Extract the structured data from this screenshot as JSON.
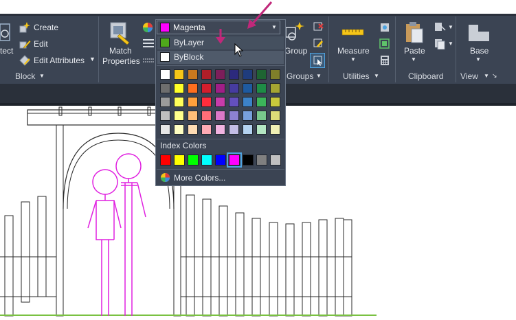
{
  "ribbon": {
    "block_panel": {
      "partial_label": "tect",
      "create_label": "Create",
      "edit_label": "Edit",
      "edit_attributes_label": "Edit Attributes",
      "title": "Block"
    },
    "match_properties": {
      "line1": "Match",
      "line2": "Properties"
    },
    "groups_panel": {
      "group_label": "Group",
      "title": "Groups"
    },
    "utilities_panel": {
      "measure_label": "Measure",
      "title": "Utilities"
    },
    "clipboard_panel": {
      "paste_label": "Paste",
      "title": "Clipboard"
    },
    "view_panel": {
      "base_label": "Base",
      "title": "View"
    }
  },
  "color_dropdown": {
    "selected_label": "Magenta",
    "selected_color": "#ff00ff",
    "bylayer_label": "ByLayer",
    "bylayer_color": "#4fa81b",
    "byblock_label": "ByBlock",
    "byblock_color": "#ffffff",
    "grid_colors": [
      [
        "#ffffff",
        "#f5c518",
        "#c8781e",
        "#b01e28",
        "#7d1e5a",
        "#2c2a7d",
        "#1f3c7d",
        "#1e6432",
        "#7f7f2a"
      ],
      [
        "#6e6e6e",
        "#ffff28",
        "#ff6e1e",
        "#d21e2d",
        "#a01e87",
        "#463ca0",
        "#1e5aa0",
        "#1e8c46",
        "#a5a532"
      ],
      [
        "#9b9b9b",
        "#ffff5a",
        "#ffa03c",
        "#ff2d3c",
        "#c83caa",
        "#6450be",
        "#3c82c8",
        "#3cb45a",
        "#c8c83c"
      ],
      [
        "#bebebe",
        "#ffff8c",
        "#ffbe78",
        "#ff6e78",
        "#dc78c8",
        "#8c82d2",
        "#78a0dc",
        "#78c88c",
        "#dcdc78"
      ],
      [
        "#e6e6e6",
        "#ffffc3",
        "#ffdcb4",
        "#ffaab4",
        "#f0b4e1",
        "#c3bee6",
        "#b4d2f0",
        "#b4e6c3",
        "#f0f0b4"
      ]
    ],
    "index_colors_label": "Index Colors",
    "index_colors": [
      "#ff0000",
      "#ffff00",
      "#00ff00",
      "#00ffff",
      "#0000ff",
      "#ff00ff",
      "#000000",
      "#808080",
      "#c0c0c0"
    ],
    "selected_index": 5,
    "more_colors_label": "More Colors..."
  },
  "annotations": {
    "arrow_color": "#c0287a"
  },
  "drawing": {
    "figure_color": "#e020e0",
    "line_color": "#2a2a2a",
    "ground_color": "#7ac142"
  }
}
